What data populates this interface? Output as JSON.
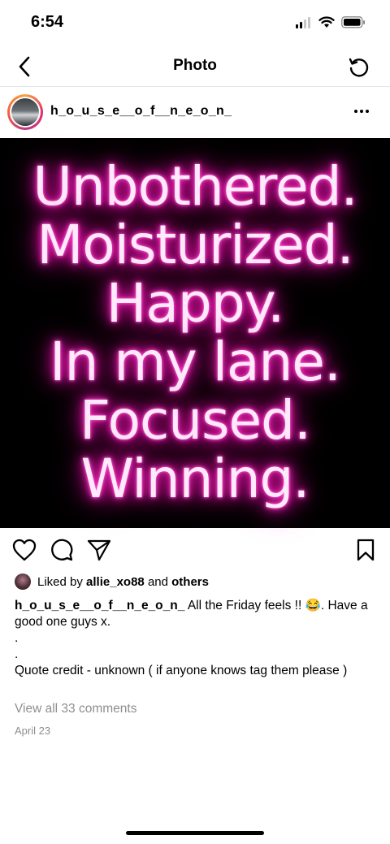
{
  "status_bar": {
    "time": "6:54"
  },
  "nav": {
    "title": "Photo",
    "back_icon": "chevron-left-icon",
    "refresh_icon": "refresh-icon"
  },
  "post": {
    "username": "h_o_u_s_e__o_f__n_e_o_n_",
    "image_lines": [
      "Unbothered.",
      "Moisturized.",
      "Happy.",
      "In my lane.",
      "Focused.",
      "Winning."
    ],
    "neon_color": "#ff1aba",
    "liked_by_prefix": "Liked by",
    "liked_by_user": "allie_xo88",
    "liked_by_and": "and",
    "liked_by_others": "others",
    "caption_text": "All the Friday feels !! 😂. Have a good one guys x.",
    "caption_dot1": ".",
    "caption_dot2": ".",
    "caption_credit": "Quote credit - unknown ( if anyone knows tag them please )",
    "comments_link": "View all 33 comments",
    "date": "April 23"
  }
}
